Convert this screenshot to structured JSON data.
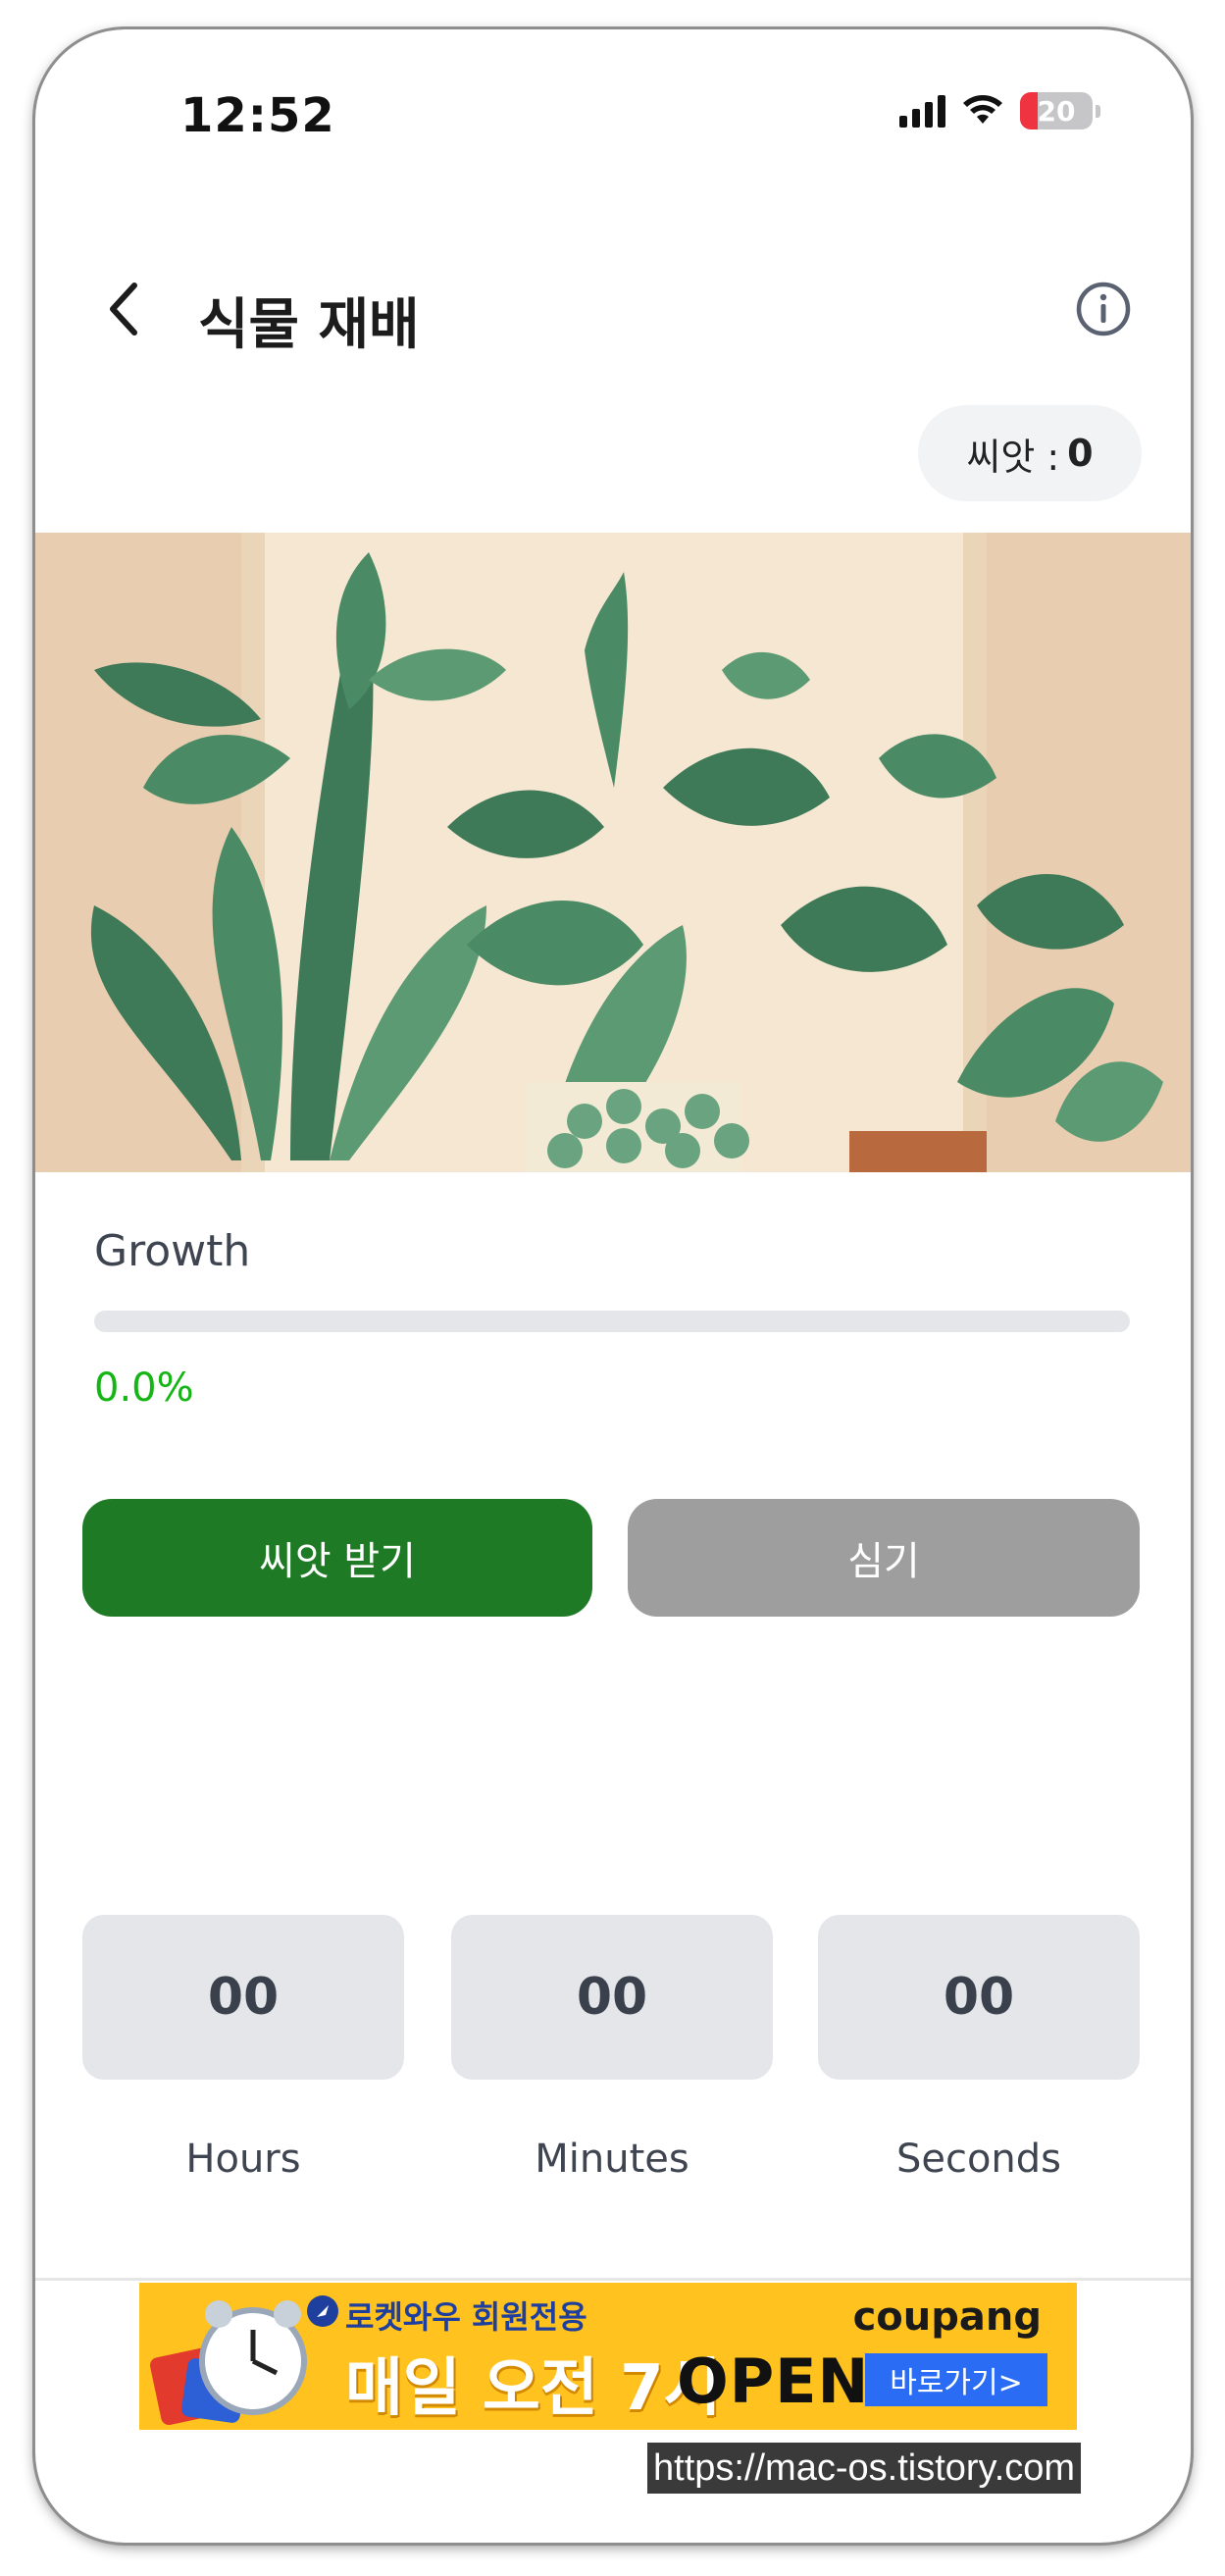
{
  "status_bar": {
    "time": "12:52",
    "battery": "20"
  },
  "header": {
    "title": "식물 재배"
  },
  "seeds": {
    "label": "씨앗 :",
    "count": "0"
  },
  "growth": {
    "label": "Growth",
    "progress_fraction": 0.0,
    "percent_text": "0.0%"
  },
  "actions": {
    "get_seed": "씨앗 받기",
    "plant": "심기"
  },
  "timer": {
    "hours": "00",
    "minutes": "00",
    "seconds": "00",
    "hours_label": "Hours",
    "minutes_label": "Minutes",
    "seconds_label": "Seconds"
  },
  "ad": {
    "top_text": "로켓와우 회원전용",
    "headline": "매일 오전 7시",
    "open_text": "OPEN",
    "brand": "coupang",
    "cta": "바로가기>"
  },
  "watermark": "https://mac-os.tistory.com",
  "colors": {
    "primary_green": "#1e7a24",
    "disabled_gray": "#9e9e9e",
    "percent_green": "#14b514",
    "timer_bg": "#e4e6ea",
    "ad_yellow": "#ffc21f"
  },
  "icons": [
    "back-chevron-icon",
    "info-icon",
    "signal-icon",
    "wifi-icon",
    "battery-icon",
    "rocket-icon",
    "alarm-clock-icon"
  ]
}
